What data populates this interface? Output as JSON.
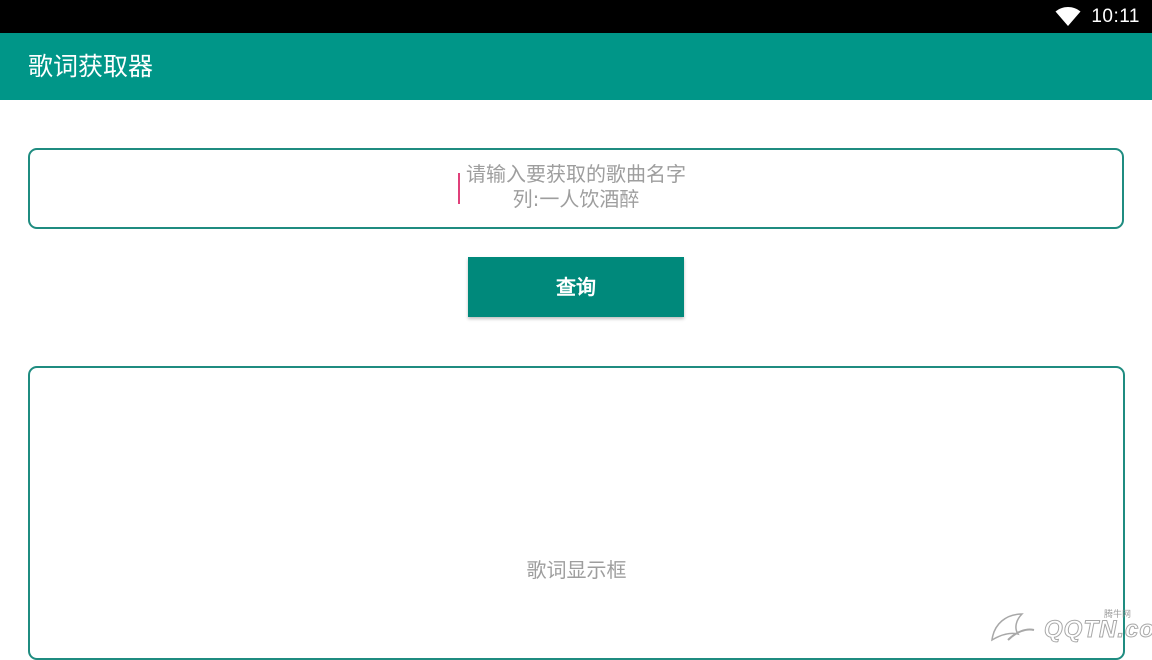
{
  "status_bar": {
    "time": "10:11",
    "icons": [
      "wifi-icon"
    ]
  },
  "app_bar": {
    "title": "歌词获取器",
    "color": "#009688"
  },
  "song_input": {
    "placeholder_line1": "请输入要获取的歌曲名字",
    "placeholder_line2": "列:一人饮酒醉",
    "value": ""
  },
  "query_button": {
    "label": "查询",
    "color": "#00897b"
  },
  "lyrics_display": {
    "placeholder": "歌词显示框"
  },
  "watermark": {
    "tag": "腾牛网",
    "text": "QQTN.com"
  },
  "colors": {
    "accent": "#009688",
    "border": "#1f8c80",
    "cursor": "#e0407a",
    "hint_text": "#9e9e9e"
  }
}
